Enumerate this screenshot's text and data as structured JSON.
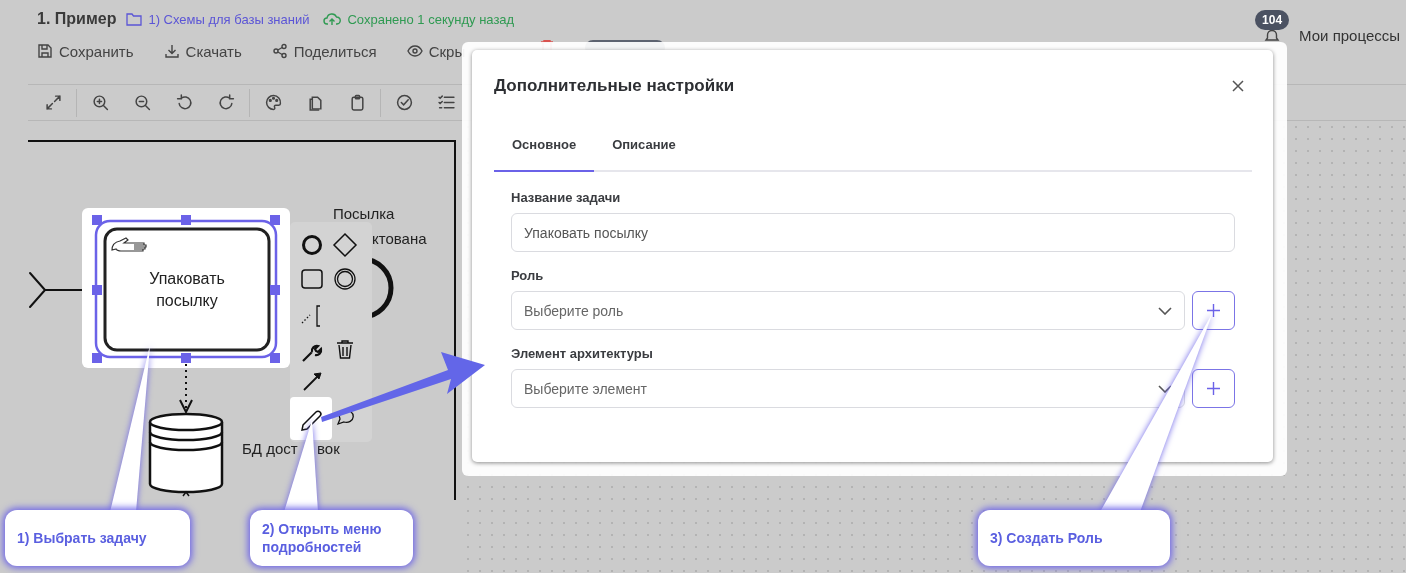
{
  "header": {
    "title": "1. Пример",
    "folder": "1) Схемы для базы знаний",
    "save_status": "Сохранено 1 секунду назад"
  },
  "actions": [
    {
      "kind": "save",
      "label": "Сохранить"
    },
    {
      "kind": "download",
      "label": "Скачать"
    },
    {
      "kind": "share",
      "label": "Поделиться"
    },
    {
      "kind": "hide",
      "label": "Скры"
    }
  ],
  "notifications": {
    "count": "104"
  },
  "user_menu": {
    "label": "Мои процессы"
  },
  "diagram": {
    "task": {
      "label": "Упаковать посылку",
      "selected": true
    },
    "event_label": [
      "Посылка",
      "ктована"
    ],
    "data_store_label": [
      "БД дост",
      "вок"
    ]
  },
  "dialog": {
    "title": "Дополнительные настройки",
    "tabs": [
      {
        "label": "Основное",
        "selected": true
      },
      {
        "label": "Описание",
        "selected": false
      }
    ],
    "fields": [
      {
        "kind": "text",
        "label": "Название задачи",
        "value": "Упаковать посылку"
      },
      {
        "kind": "select",
        "label": "Роль",
        "placeholder": "Выберите роль"
      },
      {
        "kind": "select",
        "label": "Элемент архитектуры",
        "placeholder": "Выберите элемент"
      }
    ]
  },
  "callouts": [
    {
      "text": "1) Выбрать задачу"
    },
    {
      "text": "2) Открыть меню подробностей"
    },
    {
      "text": "3) Создать Роль"
    }
  ]
}
